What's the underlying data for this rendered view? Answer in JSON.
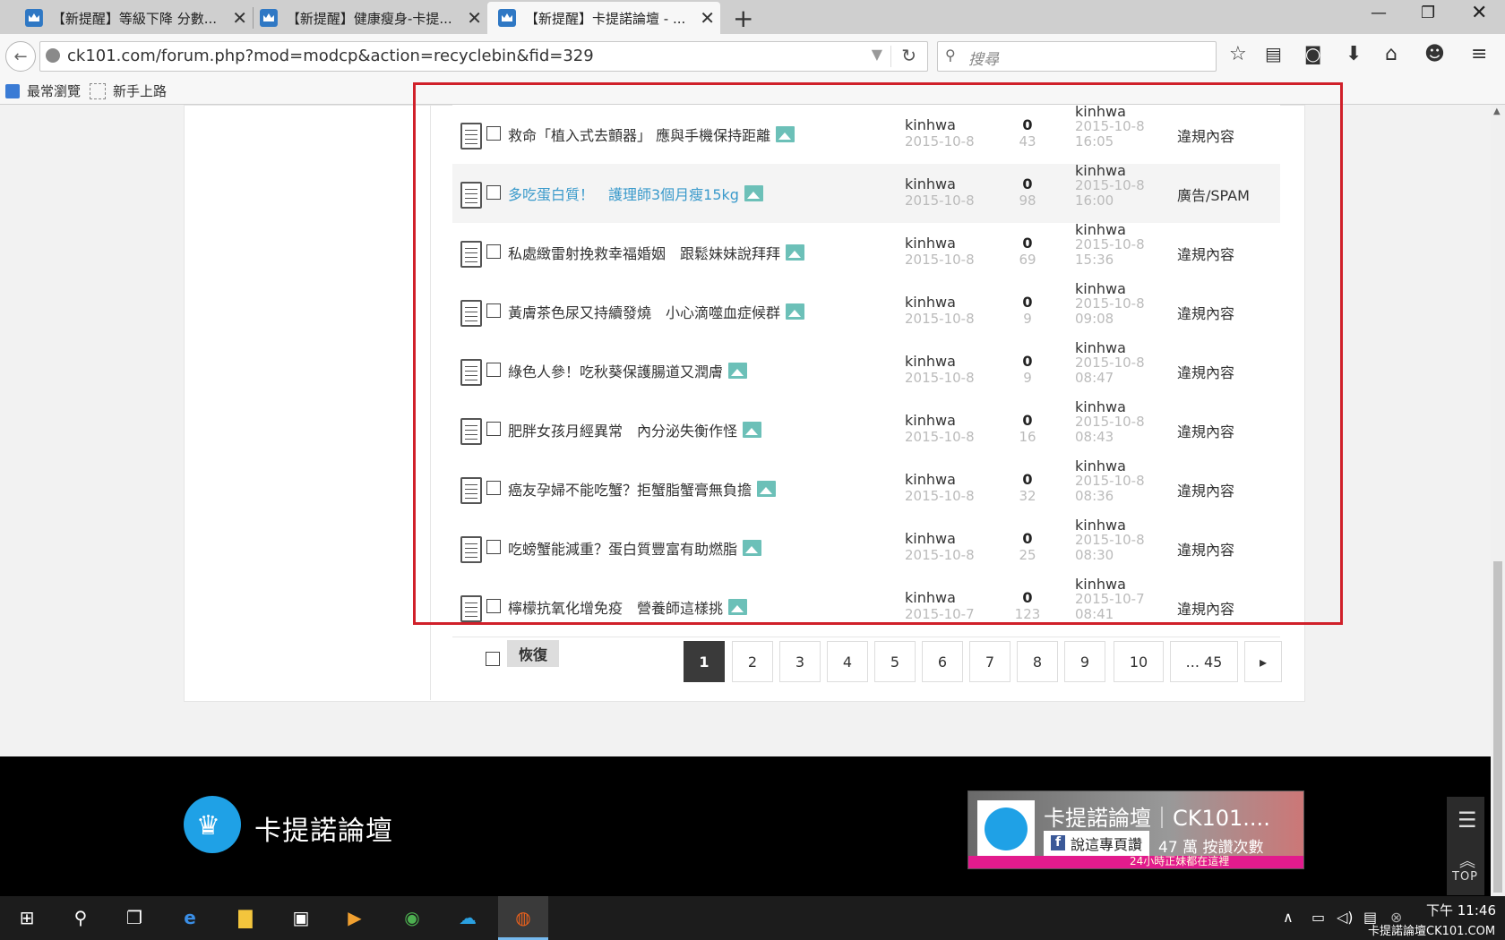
{
  "browser": {
    "tabs": [
      {
        "title": "【新提醒】等級下降 分數..."
      },
      {
        "title": "【新提醒】健康瘦身-卡提..."
      },
      {
        "title": "【新提醒】卡提諾論壇 - ..."
      }
    ],
    "url": "ck101.com/forum.php?mod=modcp&action=recyclebin&fid=329",
    "search_placeholder": "搜尋",
    "bookmarks": [
      "最常瀏覽",
      "新手上路"
    ]
  },
  "threads": [
    {
      "subject": "救命「植入式去顫器」 應與手機保持距離",
      "author": "kinhwa",
      "date": "2015-10-8",
      "replies": "0",
      "views": "43",
      "last_author": "kinhwa",
      "last_date": "2015-10-8",
      "last_time": "16:05",
      "reason": "違規內容",
      "link": false
    },
    {
      "subject": "多吃蛋白質！　護理師3個月瘦15kg",
      "author": "kinhwa",
      "date": "2015-10-8",
      "replies": "0",
      "views": "98",
      "last_author": "kinhwa",
      "last_date": "2015-10-8",
      "last_time": "16:00",
      "reason": "廣告/SPAM",
      "link": true
    },
    {
      "subject": "私處緻雷射挽救幸福婚姻　跟鬆妹妹說拜拜",
      "author": "kinhwa",
      "date": "2015-10-8",
      "replies": "0",
      "views": "69",
      "last_author": "kinhwa",
      "last_date": "2015-10-8",
      "last_time": "15:36",
      "reason": "違規內容",
      "link": false
    },
    {
      "subject": "黃膚茶色尿又持續發燒　小心滴噬血症候群",
      "author": "kinhwa",
      "date": "2015-10-8",
      "replies": "0",
      "views": "9",
      "last_author": "kinhwa",
      "last_date": "2015-10-8",
      "last_time": "09:08",
      "reason": "違規內容",
      "link": false
    },
    {
      "subject": "綠色人參！吃秋葵保護腸道又潤膚",
      "author": "kinhwa",
      "date": "2015-10-8",
      "replies": "0",
      "views": "9",
      "last_author": "kinhwa",
      "last_date": "2015-10-8",
      "last_time": "08:47",
      "reason": "違規內容",
      "link": false
    },
    {
      "subject": "肥胖女孩月經異常　內分泌失衡作怪",
      "author": "kinhwa",
      "date": "2015-10-8",
      "replies": "0",
      "views": "16",
      "last_author": "kinhwa",
      "last_date": "2015-10-8",
      "last_time": "08:43",
      "reason": "違規內容",
      "link": false
    },
    {
      "subject": "癌友孕婦不能吃蟹？拒蟹脂蟹膏無負擔",
      "author": "kinhwa",
      "date": "2015-10-8",
      "replies": "0",
      "views": "32",
      "last_author": "kinhwa",
      "last_date": "2015-10-8",
      "last_time": "08:36",
      "reason": "違規內容",
      "link": false
    },
    {
      "subject": "吃螃蟹能減重？蛋白質豐富有助燃脂",
      "author": "kinhwa",
      "date": "2015-10-8",
      "replies": "0",
      "views": "25",
      "last_author": "kinhwa",
      "last_date": "2015-10-8",
      "last_time": "08:30",
      "reason": "違規內容",
      "link": false
    },
    {
      "subject": "檸檬抗氧化增免疫　營養師這樣挑",
      "author": "kinhwa",
      "date": "2015-10-7",
      "replies": "0",
      "views": "123",
      "last_author": "kinhwa",
      "last_date": "2015-10-7",
      "last_time": "08:41",
      "reason": "違規內容",
      "link": false
    }
  ],
  "actions": {
    "restore_label": "恢復"
  },
  "pagination": [
    "1",
    "2",
    "3",
    "4",
    "5",
    "6",
    "7",
    "8",
    "9",
    "10",
    "... 45"
  ],
  "footer": {
    "site_name": "卡提諾論壇",
    "fb_page_name": "卡提諾論壇｜CK101....",
    "fb_like_label": "說這專頁讚",
    "fb_like_count": "47 萬 按讚次數",
    "fb_tagline": "24小時正妹都在這裡",
    "top_label": "TOP"
  },
  "taskbar": {
    "time": "下午 11:46",
    "watermark": "卡提諾論壇CK101.COM"
  },
  "colors": {
    "accent": "#1fa1e6",
    "link": "#3a9acb",
    "highlight_frame": "#d0202a"
  }
}
